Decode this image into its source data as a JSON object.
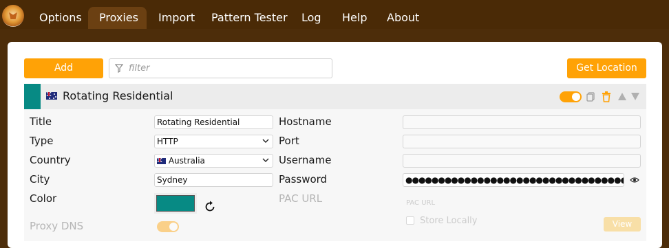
{
  "nav": {
    "tabs": [
      {
        "label": "Options"
      },
      {
        "label": "Proxies"
      },
      {
        "label": "Import"
      },
      {
        "label": "Pattern Tester"
      },
      {
        "label": "Log"
      },
      {
        "label": "Help"
      },
      {
        "label": "About"
      }
    ],
    "active_tab": "Proxies"
  },
  "toolbar": {
    "add_label": "Add",
    "filter_placeholder": "filter",
    "get_location_label": "Get Location"
  },
  "proxy": {
    "header_title": "Rotating Residential",
    "enabled": true,
    "color": "#078a84",
    "fields": {
      "title_label": "Title",
      "title_value": "Rotating Residential",
      "type_label": "Type",
      "type_value": "HTTP",
      "country_label": "Country",
      "country_value": "Australia",
      "city_label": "City",
      "city_value": "Sydney",
      "color_label": "Color",
      "proxy_dns_label": "Proxy DNS",
      "proxy_dns_enabled": true,
      "hostname_label": "Hostname",
      "hostname_value": "",
      "port_label": "Port",
      "port_value": "",
      "username_label": "Username",
      "username_value": "",
      "password_label": "Password",
      "password_value": "●●●●●●●●●●●●●●●●●●●●●●●●●●●●●●●●●●",
      "pac_url_label": "PAC URL",
      "pac_url_placeholder": "PAC URL",
      "store_locally_label": "Store Locally",
      "view_label": "View"
    }
  },
  "colors": {
    "accent": "#ffa206",
    "topbar": "#4a2a06",
    "proxy_color": "#078a84"
  }
}
